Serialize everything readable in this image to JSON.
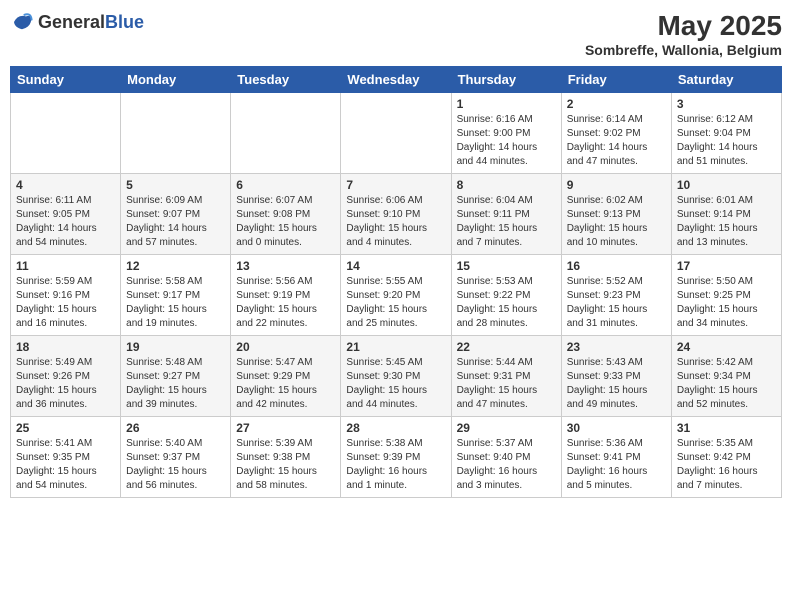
{
  "header": {
    "logo_general": "General",
    "logo_blue": "Blue",
    "month_title": "May 2025",
    "location": "Sombreffe, Wallonia, Belgium"
  },
  "days_of_week": [
    "Sunday",
    "Monday",
    "Tuesday",
    "Wednesday",
    "Thursday",
    "Friday",
    "Saturday"
  ],
  "weeks": [
    [
      {
        "day": "",
        "text": ""
      },
      {
        "day": "",
        "text": ""
      },
      {
        "day": "",
        "text": ""
      },
      {
        "day": "",
        "text": ""
      },
      {
        "day": "1",
        "text": "Sunrise: 6:16 AM\nSunset: 9:00 PM\nDaylight: 14 hours\nand 44 minutes."
      },
      {
        "day": "2",
        "text": "Sunrise: 6:14 AM\nSunset: 9:02 PM\nDaylight: 14 hours\nand 47 minutes."
      },
      {
        "day": "3",
        "text": "Sunrise: 6:12 AM\nSunset: 9:04 PM\nDaylight: 14 hours\nand 51 minutes."
      }
    ],
    [
      {
        "day": "4",
        "text": "Sunrise: 6:11 AM\nSunset: 9:05 PM\nDaylight: 14 hours\nand 54 minutes."
      },
      {
        "day": "5",
        "text": "Sunrise: 6:09 AM\nSunset: 9:07 PM\nDaylight: 14 hours\nand 57 minutes."
      },
      {
        "day": "6",
        "text": "Sunrise: 6:07 AM\nSunset: 9:08 PM\nDaylight: 15 hours\nand 0 minutes."
      },
      {
        "day": "7",
        "text": "Sunrise: 6:06 AM\nSunset: 9:10 PM\nDaylight: 15 hours\nand 4 minutes."
      },
      {
        "day": "8",
        "text": "Sunrise: 6:04 AM\nSunset: 9:11 PM\nDaylight: 15 hours\nand 7 minutes."
      },
      {
        "day": "9",
        "text": "Sunrise: 6:02 AM\nSunset: 9:13 PM\nDaylight: 15 hours\nand 10 minutes."
      },
      {
        "day": "10",
        "text": "Sunrise: 6:01 AM\nSunset: 9:14 PM\nDaylight: 15 hours\nand 13 minutes."
      }
    ],
    [
      {
        "day": "11",
        "text": "Sunrise: 5:59 AM\nSunset: 9:16 PM\nDaylight: 15 hours\nand 16 minutes."
      },
      {
        "day": "12",
        "text": "Sunrise: 5:58 AM\nSunset: 9:17 PM\nDaylight: 15 hours\nand 19 minutes."
      },
      {
        "day": "13",
        "text": "Sunrise: 5:56 AM\nSunset: 9:19 PM\nDaylight: 15 hours\nand 22 minutes."
      },
      {
        "day": "14",
        "text": "Sunrise: 5:55 AM\nSunset: 9:20 PM\nDaylight: 15 hours\nand 25 minutes."
      },
      {
        "day": "15",
        "text": "Sunrise: 5:53 AM\nSunset: 9:22 PM\nDaylight: 15 hours\nand 28 minutes."
      },
      {
        "day": "16",
        "text": "Sunrise: 5:52 AM\nSunset: 9:23 PM\nDaylight: 15 hours\nand 31 minutes."
      },
      {
        "day": "17",
        "text": "Sunrise: 5:50 AM\nSunset: 9:25 PM\nDaylight: 15 hours\nand 34 minutes."
      }
    ],
    [
      {
        "day": "18",
        "text": "Sunrise: 5:49 AM\nSunset: 9:26 PM\nDaylight: 15 hours\nand 36 minutes."
      },
      {
        "day": "19",
        "text": "Sunrise: 5:48 AM\nSunset: 9:27 PM\nDaylight: 15 hours\nand 39 minutes."
      },
      {
        "day": "20",
        "text": "Sunrise: 5:47 AM\nSunset: 9:29 PM\nDaylight: 15 hours\nand 42 minutes."
      },
      {
        "day": "21",
        "text": "Sunrise: 5:45 AM\nSunset: 9:30 PM\nDaylight: 15 hours\nand 44 minutes."
      },
      {
        "day": "22",
        "text": "Sunrise: 5:44 AM\nSunset: 9:31 PM\nDaylight: 15 hours\nand 47 minutes."
      },
      {
        "day": "23",
        "text": "Sunrise: 5:43 AM\nSunset: 9:33 PM\nDaylight: 15 hours\nand 49 minutes."
      },
      {
        "day": "24",
        "text": "Sunrise: 5:42 AM\nSunset: 9:34 PM\nDaylight: 15 hours\nand 52 minutes."
      }
    ],
    [
      {
        "day": "25",
        "text": "Sunrise: 5:41 AM\nSunset: 9:35 PM\nDaylight: 15 hours\nand 54 minutes."
      },
      {
        "day": "26",
        "text": "Sunrise: 5:40 AM\nSunset: 9:37 PM\nDaylight: 15 hours\nand 56 minutes."
      },
      {
        "day": "27",
        "text": "Sunrise: 5:39 AM\nSunset: 9:38 PM\nDaylight: 15 hours\nand 58 minutes."
      },
      {
        "day": "28",
        "text": "Sunrise: 5:38 AM\nSunset: 9:39 PM\nDaylight: 16 hours\nand 1 minute."
      },
      {
        "day": "29",
        "text": "Sunrise: 5:37 AM\nSunset: 9:40 PM\nDaylight: 16 hours\nand 3 minutes."
      },
      {
        "day": "30",
        "text": "Sunrise: 5:36 AM\nSunset: 9:41 PM\nDaylight: 16 hours\nand 5 minutes."
      },
      {
        "day": "31",
        "text": "Sunrise: 5:35 AM\nSunset: 9:42 PM\nDaylight: 16 hours\nand 7 minutes."
      }
    ]
  ]
}
